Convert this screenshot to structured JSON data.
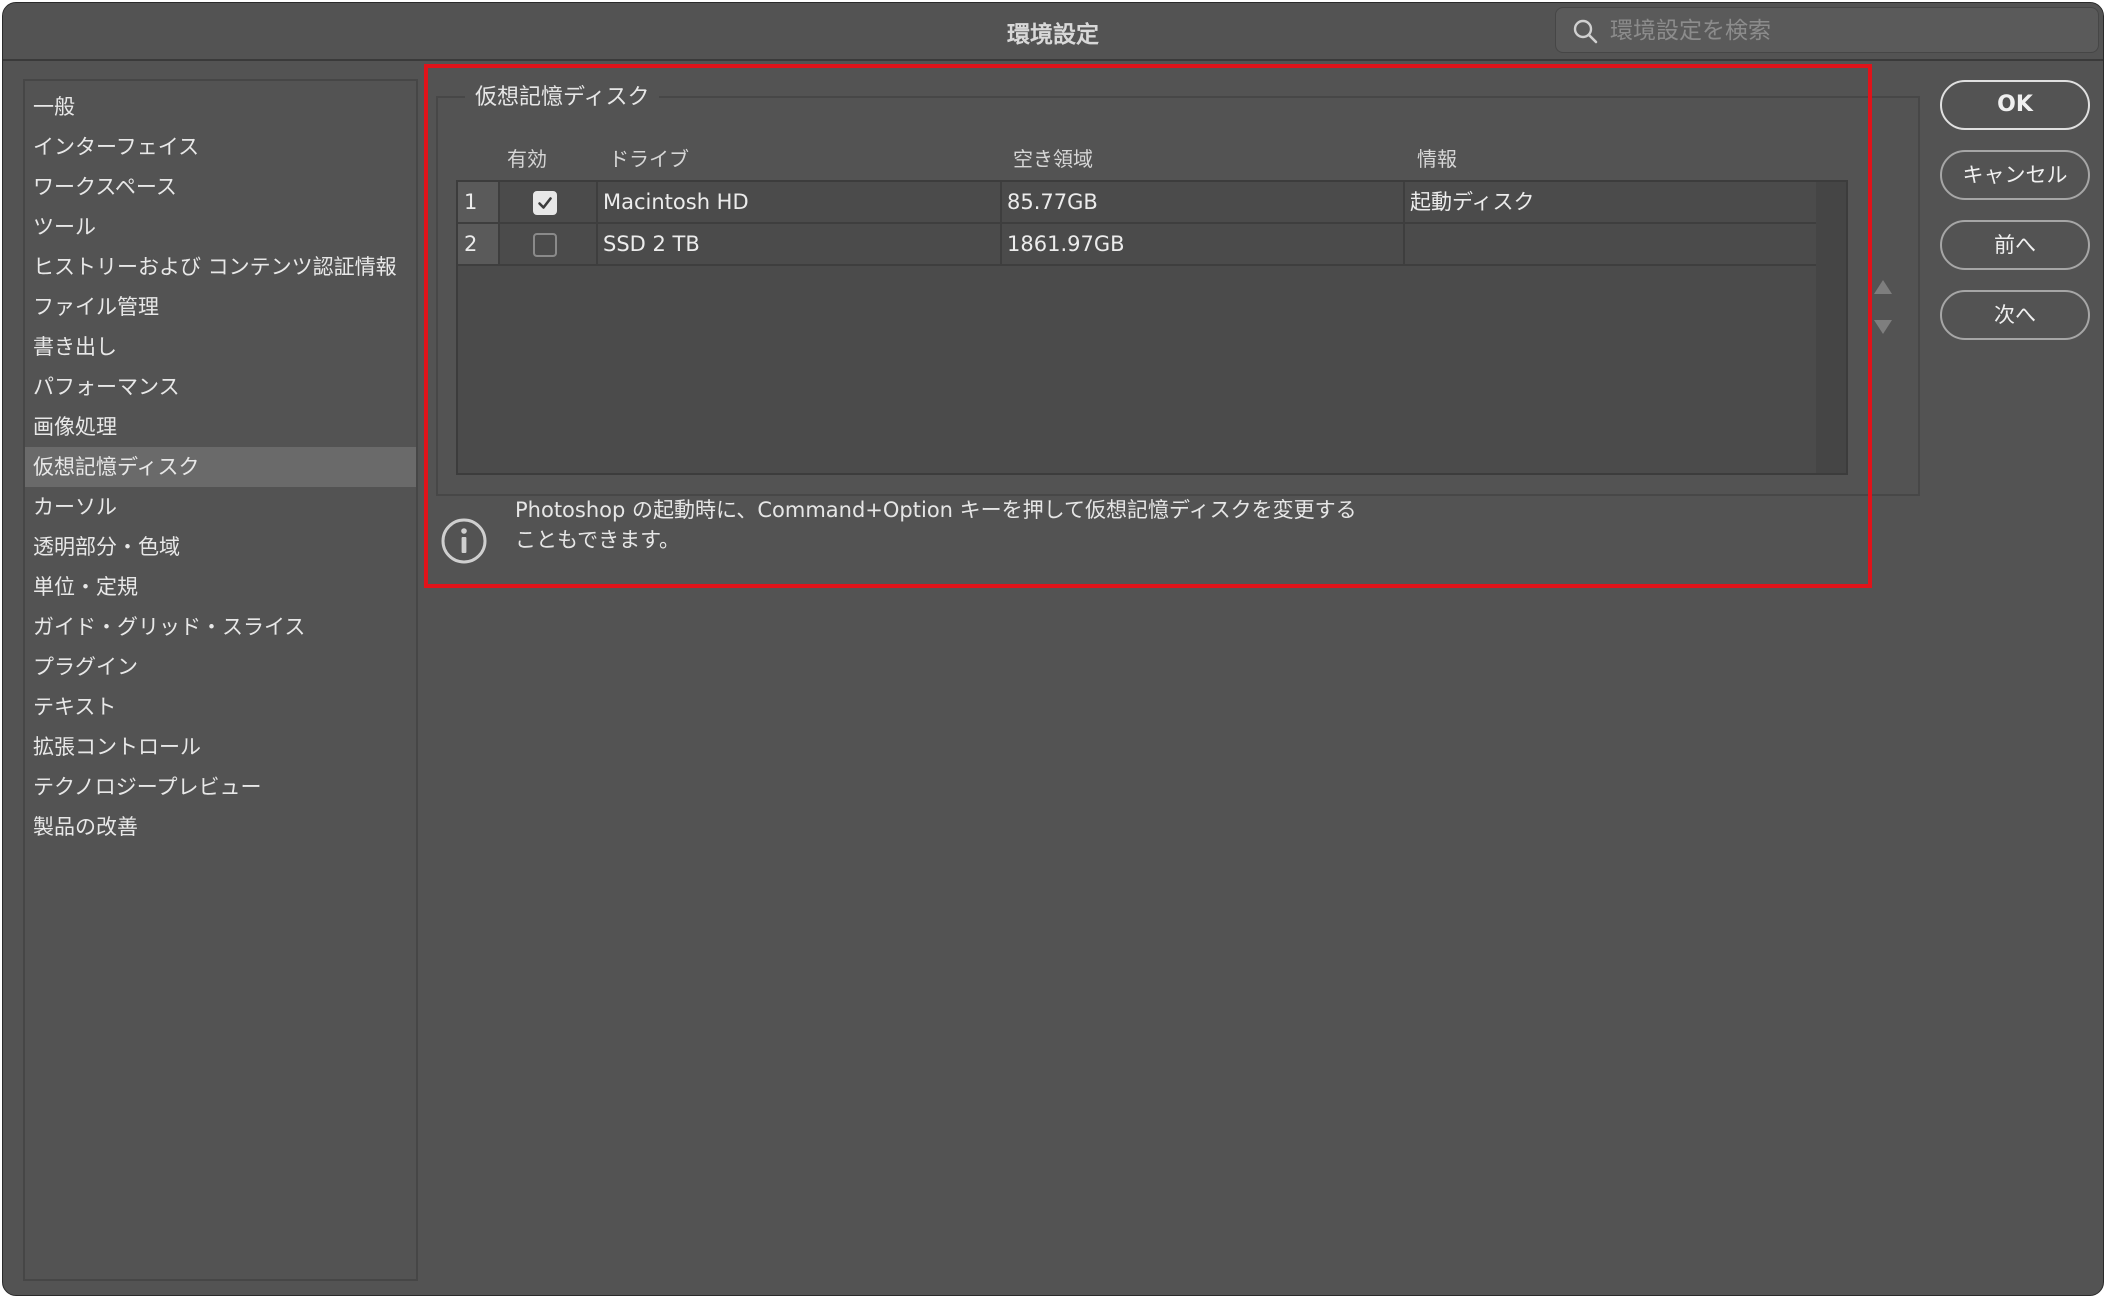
{
  "window": {
    "title": "環境設定"
  },
  "search": {
    "placeholder": "環境設定を検索",
    "icon": "search-icon"
  },
  "sidebar": {
    "items": [
      {
        "label": "一般",
        "active": false
      },
      {
        "label": "インターフェイス",
        "active": false
      },
      {
        "label": "ワークスペース",
        "active": false
      },
      {
        "label": "ツール",
        "active": false
      },
      {
        "label": "ヒストリーおよび コンテンツ認証情報",
        "active": false
      },
      {
        "label": "ファイル管理",
        "active": false
      },
      {
        "label": "書き出し",
        "active": false
      },
      {
        "label": "パフォーマンス",
        "active": false
      },
      {
        "label": "画像処理",
        "active": false
      },
      {
        "label": "仮想記憶ディスク",
        "active": true
      },
      {
        "label": "カーソル",
        "active": false
      },
      {
        "label": "透明部分・色域",
        "active": false
      },
      {
        "label": "単位・定規",
        "active": false
      },
      {
        "label": "ガイド・グリッド・スライス",
        "active": false
      },
      {
        "label": "プラグイン",
        "active": false
      },
      {
        "label": "テキスト",
        "active": false
      },
      {
        "label": "拡張コントロール",
        "active": false
      },
      {
        "label": "テクノロジープレビュー",
        "active": false
      },
      {
        "label": "製品の改善",
        "active": false
      }
    ]
  },
  "scratch": {
    "group_title": "仮想記憶ディスク",
    "columns": {
      "enabled": "有効",
      "drive": "ドライブ",
      "free_space": "空き領域",
      "info": "情報"
    },
    "rows": [
      {
        "index": "1",
        "enabled": true,
        "drive": "Macintosh HD",
        "free_space": "85.77GB",
        "info": "起動ディスク"
      },
      {
        "index": "2",
        "enabled": false,
        "drive": "SSD 2 TB",
        "free_space": "1861.97GB",
        "info": ""
      }
    ],
    "info_line1": "Photoshop の起動時に、Command+Option キーを押して仮想記憶ディスクを変更する",
    "info_line2": "こともできます。"
  },
  "buttons": {
    "ok": "OK",
    "cancel": "キャンセル",
    "prev": "前へ",
    "next": "次へ"
  },
  "colors": {
    "highlight_frame": "#e0131a",
    "background": "#535353"
  }
}
